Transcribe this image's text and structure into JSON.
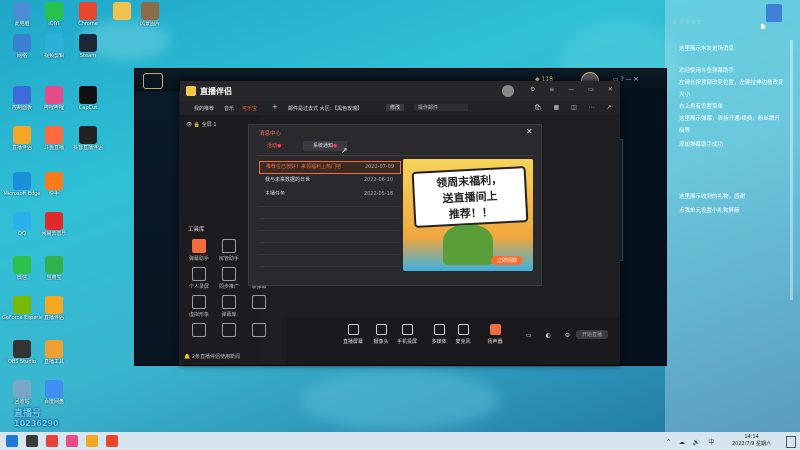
{
  "desktop": {
    "icons": [
      {
        "label": "此电脑",
        "color": "#4a8fd6"
      },
      {
        "label": "iQIYI",
        "color": "#27c24c"
      },
      {
        "label": "Chrome",
        "color": "#e8452c"
      },
      {
        "label": "",
        "color": "#f2c14e"
      },
      {
        "label": "风景图片",
        "color": "#8b6b4a"
      },
      {
        "label": "网络",
        "color": "#3b7fd1"
      },
      {
        "label": "视频剪辑",
        "color": "#2bb0d9"
      },
      {
        "label": "Steam",
        "color": "#1b2838"
      },
      {
        "label": "控制面板",
        "color": "#3f6ad8"
      },
      {
        "label": "哔哩哔哩",
        "color": "#e84c88"
      },
      {
        "label": "CapCut",
        "color": "#111111"
      },
      {
        "label": "直播伴侣",
        "color": "#f5a623"
      },
      {
        "label": "斗鱼直播",
        "color": "#ff6a3d"
      },
      {
        "label": "抖音直播伴侣",
        "color": "#222222"
      },
      {
        "label": "Microsoft Edge",
        "color": "#1b8fd8"
      },
      {
        "label": "快手",
        "color": "#ff7a1a"
      },
      {
        "label": "QQ",
        "color": "#2ab0ed"
      },
      {
        "label": "网易云音乐",
        "color": "#e02a2a"
      },
      {
        "label": "微信",
        "color": "#2bc14b"
      },
      {
        "label": "应用宝",
        "color": "#2fb14d"
      },
      {
        "label": "GeForce Experience",
        "color": "#76b900"
      },
      {
        "label": "直播伴侣",
        "color": "#f5a623"
      },
      {
        "label": "OBS Studio",
        "color": "#333333"
      },
      {
        "label": "直播工具",
        "color": "#f0a030"
      },
      {
        "label": "回收站",
        "color": "#7aa6c8"
      },
      {
        "label": "百度网盘",
        "color": "#3f8ef0"
      }
    ],
    "watermark": {
      "line1": "直播号",
      "line2": "10236290"
    }
  },
  "right_panel": {
    "lines": [
      "这里展示水友进场消息",
      "欢迎使用斗鱼弹幕助手",
      "左键长按顶部改变位置，左键拉伸边框改变",
      "大小",
      "右上角有设置菜单",
      "这里展示弹幕，表扬开通/续费，粉丝牌升",
      "级等",
      "添加弹幕助手成功",
      "这里展示收到的礼物，感谢",
      "点我单元设置小礼物屏蔽"
    ]
  },
  "app": {
    "title": "直播伴侣",
    "nav_tabs": [
      "我的推荐",
      "音乐",
      "可乐宝"
    ],
    "nav_add": "+",
    "room_title": "邮件是过去式 大区：【黑色玫瑰】",
    "modify": "修改",
    "announce": "操作邮件",
    "scene_label": "全屏 1",
    "tools_heading": "工具库",
    "tools": [
      "弹幕助手",
      "房管助手",
      "预约直播",
      "个人录屏",
      "同步推广",
      "录弹幕",
      "虚拟形象",
      "弹幕库",
      "",
      "",
      "",
      ""
    ],
    "footer_note": "2条直播伴侣使用新闻",
    "bottom_buttons": [
      "直播屏幕",
      "摄像头",
      "手机投屏",
      "多媒体",
      "麦克风",
      "扬声器"
    ],
    "start_button": "开始直播"
  },
  "modal": {
    "title": "消息中心",
    "tabs": [
      "活动",
      "系统通知"
    ],
    "messages": [
      {
        "title": "推荐位已放好！来领福利上热门吧",
        "date": "2022-07-09",
        "highlight": true
      },
      {
        "title": "我与未来数据的日世",
        "date": "2022-06-10",
        "highlight": false
      },
      {
        "title": "主播任务",
        "date": "2022-05-18",
        "highlight": false
      }
    ],
    "banner_line1": "领周末福利，",
    "banner_line2": "送直播间上",
    "banner_line3": "推荐！！",
    "banner_button": "立即领取",
    "close": "✕"
  },
  "game": {
    "level": "118"
  },
  "taskbar": {
    "time": "14:14",
    "date": "2022/7/9 星期六"
  }
}
